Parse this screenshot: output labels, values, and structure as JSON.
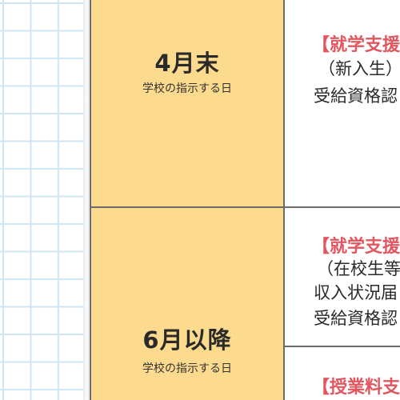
{
  "schedule": {
    "rows": [
      {
        "date": "4月末",
        "note": "学校の指示する日",
        "lines": [
          "【就学支援",
          "（新入生）",
          "受給資格認"
        ]
      },
      {
        "date": "6月以降",
        "note": "学校の指示する日",
        "lines": [
          "【就学支援",
          "（在校生等",
          "収入状況届",
          "受給資格認"
        ],
        "next_heading": "【授業料支"
      }
    ]
  },
  "colors": {
    "date_column": "#fcda8e",
    "heading_red": "#e1565f",
    "grid_line": "#cfe6f4",
    "border": "#6b6b6b"
  }
}
